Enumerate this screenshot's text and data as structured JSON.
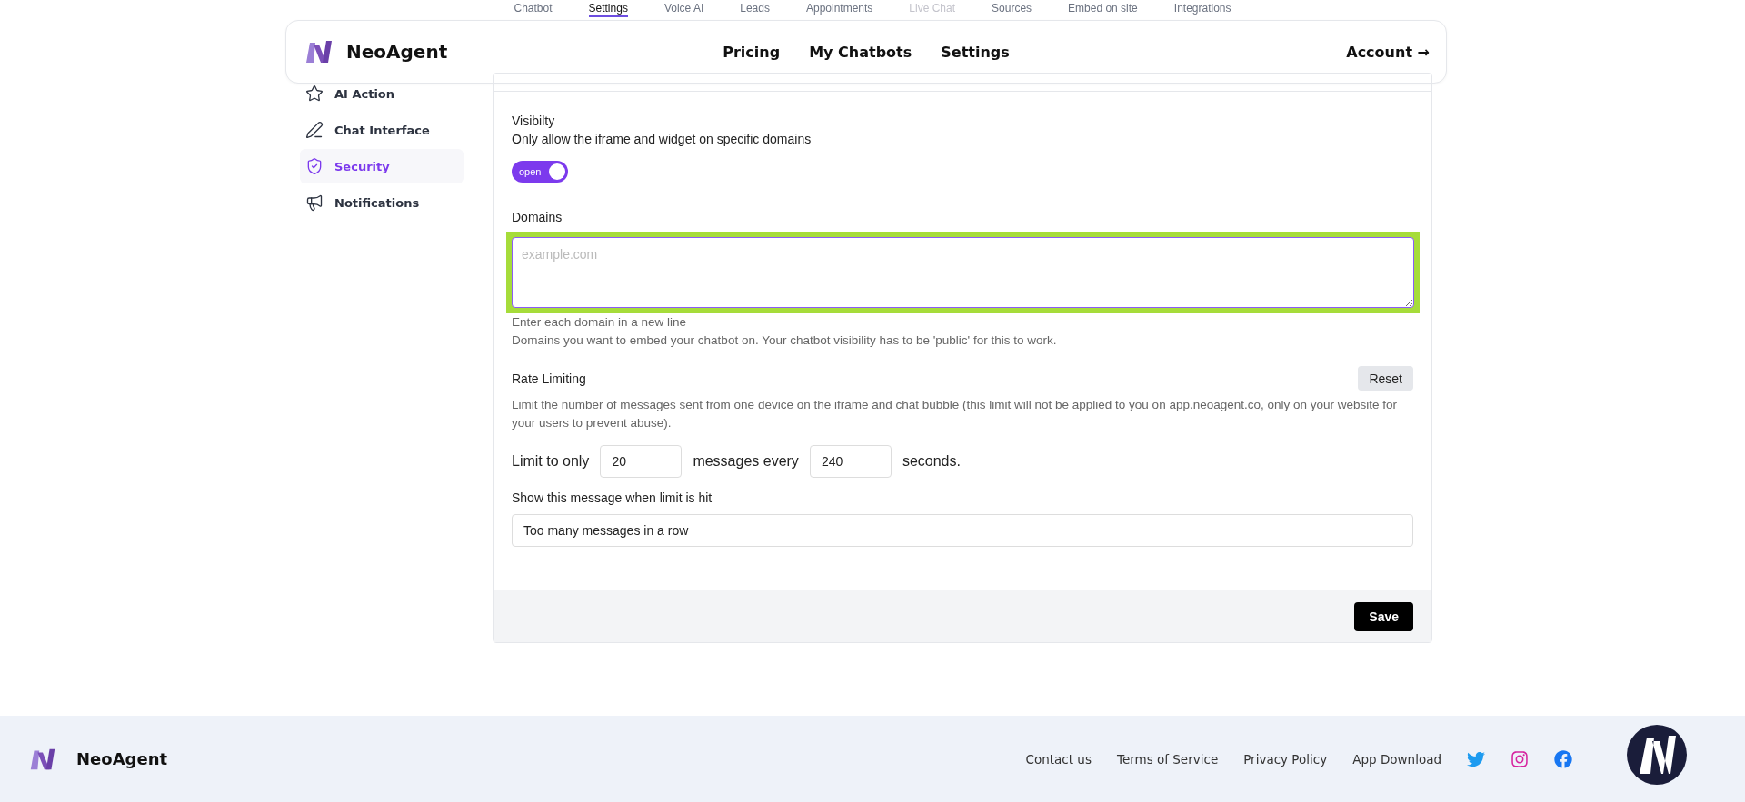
{
  "top_tabs": [
    {
      "label": "Chatbot",
      "selected": false,
      "disabled": false
    },
    {
      "label": "Settings",
      "selected": true,
      "disabled": false
    },
    {
      "label": "Voice AI",
      "selected": false,
      "disabled": false
    },
    {
      "label": "Leads",
      "selected": false,
      "disabled": false
    },
    {
      "label": "Appointments",
      "selected": false,
      "disabled": false
    },
    {
      "label": "Live Chat",
      "selected": false,
      "disabled": true
    },
    {
      "label": "Sources",
      "selected": false,
      "disabled": false
    },
    {
      "label": "Embed on site",
      "selected": false,
      "disabled": false
    },
    {
      "label": "Integrations",
      "selected": false,
      "disabled": false
    }
  ],
  "header": {
    "brand": "NeoAgent",
    "nav": [
      "Pricing",
      "My Chatbots",
      "Settings"
    ],
    "account": "Account →"
  },
  "sidebar": {
    "items": [
      {
        "label": "AI Action",
        "selected": false
      },
      {
        "label": "Chat Interface",
        "selected": false
      },
      {
        "label": "Security",
        "selected": true
      },
      {
        "label": "Notifications",
        "selected": false
      }
    ]
  },
  "visibility": {
    "label": "Visibilty",
    "description": "Only allow the iframe and widget on specific domains",
    "toggle": {
      "label": "open",
      "on": true
    }
  },
  "domains": {
    "label": "Domains",
    "placeholder": "example.com",
    "highlighted": true,
    "hint": "Enter each domain in a new line",
    "note": "Domains you want to embed your chatbot on. Your chatbot visibility has to be 'public' for this to work."
  },
  "rate_limiting": {
    "label": "Rate Limiting",
    "reset": "Reset",
    "description": "Limit the number of messages sent from one device on the iframe and chat bubble (this limit will not be applied to you on app.neoagent.co, only on your website for your users to prevent abuse).",
    "limit_prefix": "Limit to only",
    "messages": "20",
    "limit_middle": "messages every",
    "seconds": "240",
    "limit_suffix": "seconds.",
    "message_label": "Show this message when limit is hit",
    "message": "Too many messages in a row"
  },
  "save": "Save",
  "footer": {
    "brand": "NeoAgent",
    "links": [
      "Contact us",
      "Terms of Service",
      "Privacy Policy",
      "App Download"
    ]
  }
}
